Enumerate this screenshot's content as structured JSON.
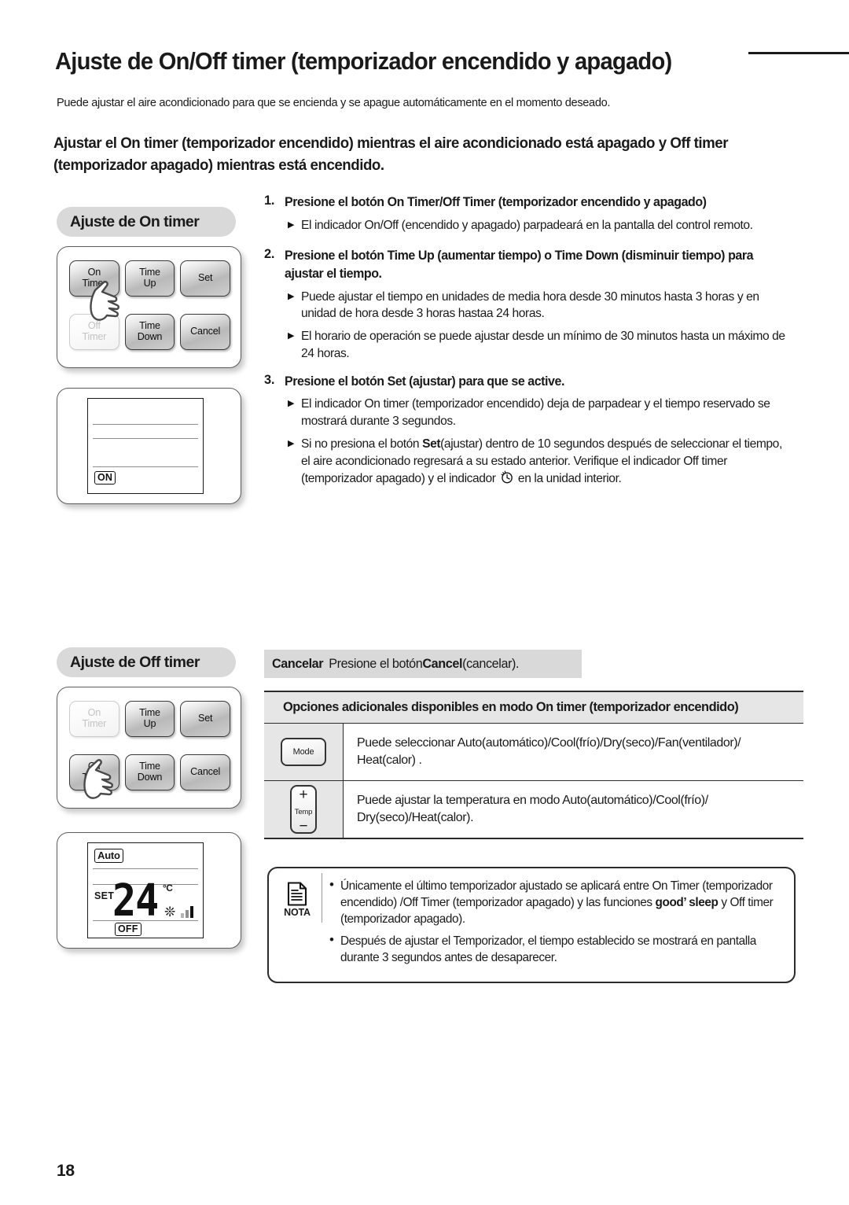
{
  "document": {
    "page_number": "18",
    "title": "Ajuste de On/Off timer (temporizador encendido y apagado)",
    "intro": "Puede ajustar el aire acondicionado para que se encienda y se apague automáticamente en el momento deseado.",
    "sub_heading": "Ajustar el On timer (temporizador encendido) mientras el aire acondicionado está apagado y Off timer (temporizador apagado) mientras está encendido."
  },
  "left_column": {
    "on_section": {
      "pill_label": "Ajuste de On timer",
      "remote_buttons": [
        {
          "label_line1": "On",
          "label_line2": "Timer",
          "state": "active"
        },
        {
          "label_line1": "Time",
          "label_line2": "Up",
          "state": "active"
        },
        {
          "label_line1": "Set",
          "label_line2": "",
          "state": "active"
        },
        {
          "label_line1": "Off",
          "label_line2": "Timer",
          "state": "dimmed"
        },
        {
          "label_line1": "Time",
          "label_line2": "Down",
          "state": "active"
        },
        {
          "label_line1": "Cancel",
          "label_line2": "",
          "state": "active"
        }
      ],
      "lcd": {
        "status_tag": "ON"
      }
    },
    "off_section": {
      "pill_label": "Ajuste de Off timer",
      "remote_buttons": [
        {
          "label_line1": "On",
          "label_line2": "Timer",
          "state": "dimmed"
        },
        {
          "label_line1": "Time",
          "label_line2": "Up",
          "state": "active"
        },
        {
          "label_line1": "Set",
          "label_line2": "",
          "state": "active"
        },
        {
          "label_line1": "Off",
          "label_line2": "Timer",
          "state": "active"
        },
        {
          "label_line1": "Time",
          "label_line2": "Down",
          "state": "active"
        },
        {
          "label_line1": "Cancel",
          "label_line2": "",
          "state": "active"
        }
      ],
      "lcd": {
        "mode_tag": "Auto",
        "set_label": "SET",
        "temperature": "24",
        "unit": "°C",
        "status_tag": "OFF",
        "fan_icon": "fan-icon",
        "fan_bars": 3
      }
    }
  },
  "steps": [
    {
      "number": "1.",
      "text": "Presione el botón On Timer/Off Timer (temporizador encendido y apagado)",
      "bullets": [
        "El indicador On/Off (encendido y apagado) parpadeará en la pantalla del control remoto."
      ]
    },
    {
      "number": "2.",
      "text": "Presione el botón Time Up (aumentar tiempo) o Time Down (disminuir tiempo) para ajustar el tiempo.",
      "bullets": [
        "Puede ajustar el tiempo en unidades de media hora desde 30 minutos hasta 3 horas y en unidad de hora desde 3 horas hastaa 24 horas.",
        "El horario de operación se puede ajustar desde un mínimo de 30 minutos hasta un máximo de 24 horas."
      ]
    },
    {
      "number": "3.",
      "text": "Presione el botón Set (ajustar) para que se active.",
      "bullets": [
        "El indicador On timer (temporizador encendido) deja de parpadear y el tiempo reservado se mostrará durante 3 segundos."
      ],
      "bullet_rich": {
        "part1": "Si no presiona el botón ",
        "bold": "Set",
        "part2": "(ajustar) dentro de 10 segundos después de seleccionar el tiempo, el aire acondicionado regresará a su estado anterior. Verifique el indicador Off timer (temporizador apagado) y el indicador ",
        "icon": "clock-icon",
        "part3": " en la unidad interior."
      }
    }
  ],
  "cancel_band": {
    "label": "Cancelar",
    "text_before": "Presione el botón ",
    "button_name": "Cancel",
    "text_after": " (cancelar)."
  },
  "options_table": {
    "header": "Opciones adicionales disponibles en modo On timer (temporizador encendido)",
    "rows": [
      {
        "icon_label": "Mode",
        "icon_type": "mode-button",
        "text": "Puede seleccionar Auto(automático)/Cool(frío)/Dry(seco)/Fan(ventilador)/ Heat(calor) ."
      },
      {
        "icon_label": "Temp",
        "icon_type": "temp-button",
        "icon_plus": "+",
        "icon_minus": "−",
        "text": "Puede ajustar la temperatura en modo Auto(automático)/Cool(frío)/ Dry(seco)/Heat(calor)."
      }
    ]
  },
  "note_box": {
    "label": "NOTA",
    "items": [
      {
        "part1": "Únicamente el último temporizador ajustado se aplicará entre On Timer (temporizador encendido) /Off Timer (temporizador apagado) y las funciones ",
        "bold": "good’ sleep",
        "part2": " y Off timer (temporizador apagado)."
      },
      {
        "part1": "Después de ajustar el Temporizador, el tiempo establecido se mostrará en pantalla durante 3 segundos antes de desaparecer.",
        "bold": "",
        "part2": ""
      }
    ]
  },
  "colors": {
    "pill_gray": "#d9d9d9",
    "table_gray": "#e6e6e6",
    "ink": "#1a1a1a",
    "rule": "#2b2b2b"
  }
}
